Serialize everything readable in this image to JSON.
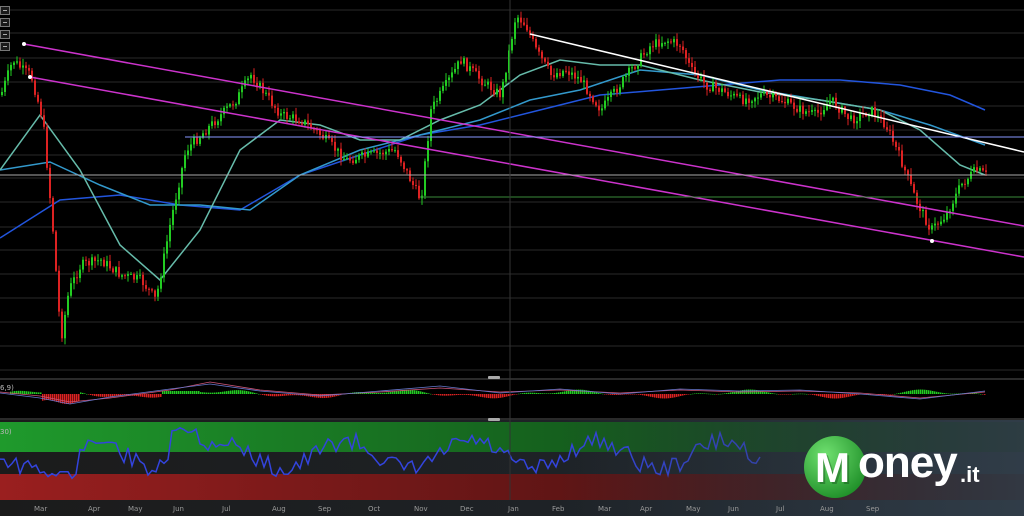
{
  "chart_data": [
    {
      "type": "candlestick",
      "panel": "price",
      "x_labels": [],
      "series": [
        {
          "kind": "candles",
          "up_color": "#22cc22",
          "down_color": "#dd2222"
        },
        {
          "kind": "moving-average",
          "color": "#2255dd"
        },
        {
          "kind": "moving-average",
          "color": "#3399cc"
        },
        {
          "kind": "moving-average",
          "color": "#66bbaa"
        }
      ],
      "trendlines": {
        "channel_color": "#cc33cc",
        "resistance_color": "#ffffff",
        "horizontal_levels_color": "#8899ff"
      },
      "grid": true
    },
    {
      "type": "histogram",
      "panel": "oscillator",
      "label": "6,9)",
      "colors": {
        "positive": "#22cc22",
        "negative": "#dd2222"
      }
    },
    {
      "type": "line",
      "panel": "rsi",
      "label": "30)",
      "colors": {
        "line": "#3344dd",
        "overbought_zone": "#1f8a2a",
        "oversold_zone": "#8a1f1f"
      }
    }
  ],
  "x_axis": [
    "Mar",
    "Apr",
    "May",
    "Jun",
    "Jul",
    "Aug",
    "Sep",
    "Oct",
    "Nov",
    "Dec",
    "Jan",
    "Feb",
    "Mar",
    "Apr",
    "May",
    "Jun",
    "Jul",
    "Aug",
    "Sep"
  ],
  "logo": {
    "brand": "Money",
    "tld": ".it",
    "brand_color": "#2aa836"
  }
}
